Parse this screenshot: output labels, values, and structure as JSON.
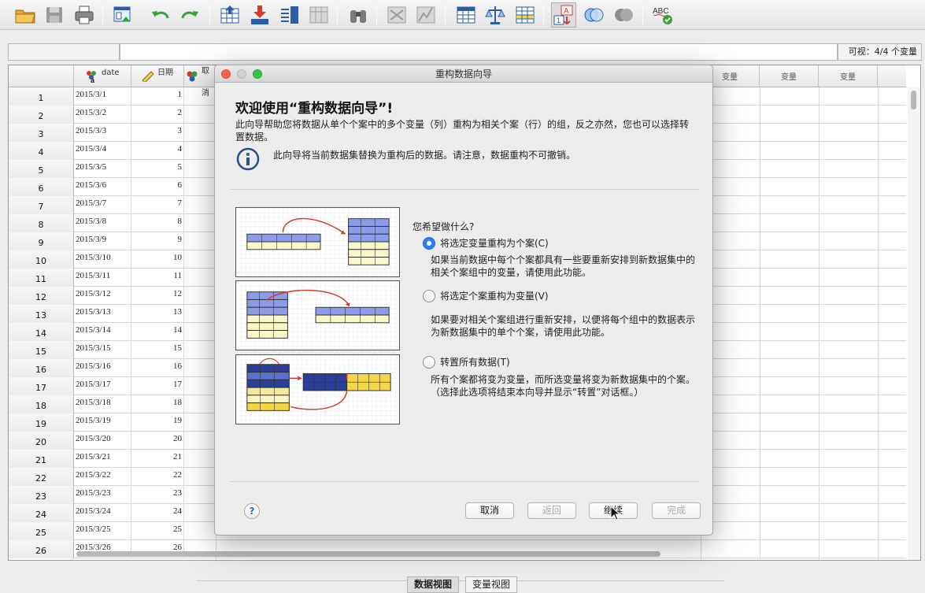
{
  "toolbar": {
    "icons": [
      "open-folder-icon",
      "save-icon",
      "print-icon",
      "recall-dialog-icon",
      "undo-icon",
      "redo-icon",
      "goto-case-icon",
      "goto-variable-icon",
      "variables-icon",
      "run-descriptives-icon",
      "find-icon",
      "insert-cases-icon",
      "insert-variable-icon",
      "split-file-icon",
      "weight-cases-icon",
      "select-cases-icon",
      "value-labels-icon",
      "use-sets-icon",
      "show-all-variables-icon",
      "spell-check-icon"
    ],
    "spell_label": "ABC"
  },
  "cellbar": {
    "cell_ref": "",
    "cell_value": "",
    "visible_count": "可视：4/4 个变量"
  },
  "grid": {
    "columns": [
      {
        "name": "date",
        "icon": "date-variable-icon"
      },
      {
        "name": "日期",
        "icon": "scale-variable-icon"
      },
      {
        "name": "取消",
        "icon": "nominal-variable-icon"
      }
    ],
    "empty_var_label": "变量",
    "rows": [
      {
        "n": "1",
        "date": "2015/3/1",
        "day": "1"
      },
      {
        "n": "2",
        "date": "2015/3/2",
        "day": "2"
      },
      {
        "n": "3",
        "date": "2015/3/3",
        "day": "3"
      },
      {
        "n": "4",
        "date": "2015/3/4",
        "day": "4"
      },
      {
        "n": "5",
        "date": "2015/3/5",
        "day": "5"
      },
      {
        "n": "6",
        "date": "2015/3/6",
        "day": "6"
      },
      {
        "n": "7",
        "date": "2015/3/7",
        "day": "7"
      },
      {
        "n": "8",
        "date": "2015/3/8",
        "day": "8"
      },
      {
        "n": "9",
        "date": "2015/3/9",
        "day": "9"
      },
      {
        "n": "10",
        "date": "2015/3/10",
        "day": "10"
      },
      {
        "n": "11",
        "date": "2015/3/11",
        "day": "11"
      },
      {
        "n": "12",
        "date": "2015/3/12",
        "day": "12"
      },
      {
        "n": "13",
        "date": "2015/3/13",
        "day": "13"
      },
      {
        "n": "14",
        "date": "2015/3/14",
        "day": "14"
      },
      {
        "n": "15",
        "date": "2015/3/15",
        "day": "15"
      },
      {
        "n": "16",
        "date": "2015/3/16",
        "day": "16"
      },
      {
        "n": "17",
        "date": "2015/3/17",
        "day": "17"
      },
      {
        "n": "18",
        "date": "2015/3/18",
        "day": "18"
      },
      {
        "n": "19",
        "date": "2015/3/19",
        "day": "19"
      },
      {
        "n": "20",
        "date": "2015/3/20",
        "day": "20"
      },
      {
        "n": "21",
        "date": "2015/3/21",
        "day": "21"
      },
      {
        "n": "22",
        "date": "2015/3/22",
        "day": "22"
      },
      {
        "n": "23",
        "date": "2015/3/23",
        "day": "23"
      },
      {
        "n": "24",
        "date": "2015/3/24",
        "day": "24"
      },
      {
        "n": "25",
        "date": "2015/3/25",
        "day": "25"
      },
      {
        "n": "26",
        "date": "2015/3/26",
        "day": "26"
      }
    ]
  },
  "view_tabs": {
    "data_view": "数据视图",
    "variable_view": "变量视图"
  },
  "dialog": {
    "title": "重构数据向导",
    "heading": "欢迎使用“重构数据向导”!",
    "intro": "此向导帮助您将数据从单个个案中的多个变量（列）重构为相关个案（行）的组，反之亦然，您也可以选择转置数据。",
    "warning": "此向导将当前数据集替换为重构后的数据。请注意，数据重构不可撤销。",
    "question": "您希望做什么?",
    "options": [
      {
        "label": "将选定变量重构为个案(C)",
        "desc": "如果当前数据中每个个案都具有一些要重新安排到新数据集中的相关个案组中的变量，请使用此功能。",
        "selected": true
      },
      {
        "label": "将选定个案重构为变量(V)",
        "desc": "如果要对相关个案组进行重新安排，以便将每个组中的数据表示为新数据集中的单个个案，请使用此功能。",
        "selected": false
      },
      {
        "label": "转置所有数据(T)",
        "desc": "所有个案都将变为变量，而所选变量将变为新数据集中的个案。（选择此选项将结束本向导并显示“转置”对话框。）",
        "selected": false
      }
    ],
    "buttons": {
      "help": "?",
      "cancel": "取消",
      "back": "返回",
      "continue": "继续",
      "finish": "完成"
    }
  },
  "colors": {
    "accent": "#2f7ef7",
    "close": "#fc5f57",
    "minimize": "#d0d0d0",
    "zoom": "#33c748"
  }
}
